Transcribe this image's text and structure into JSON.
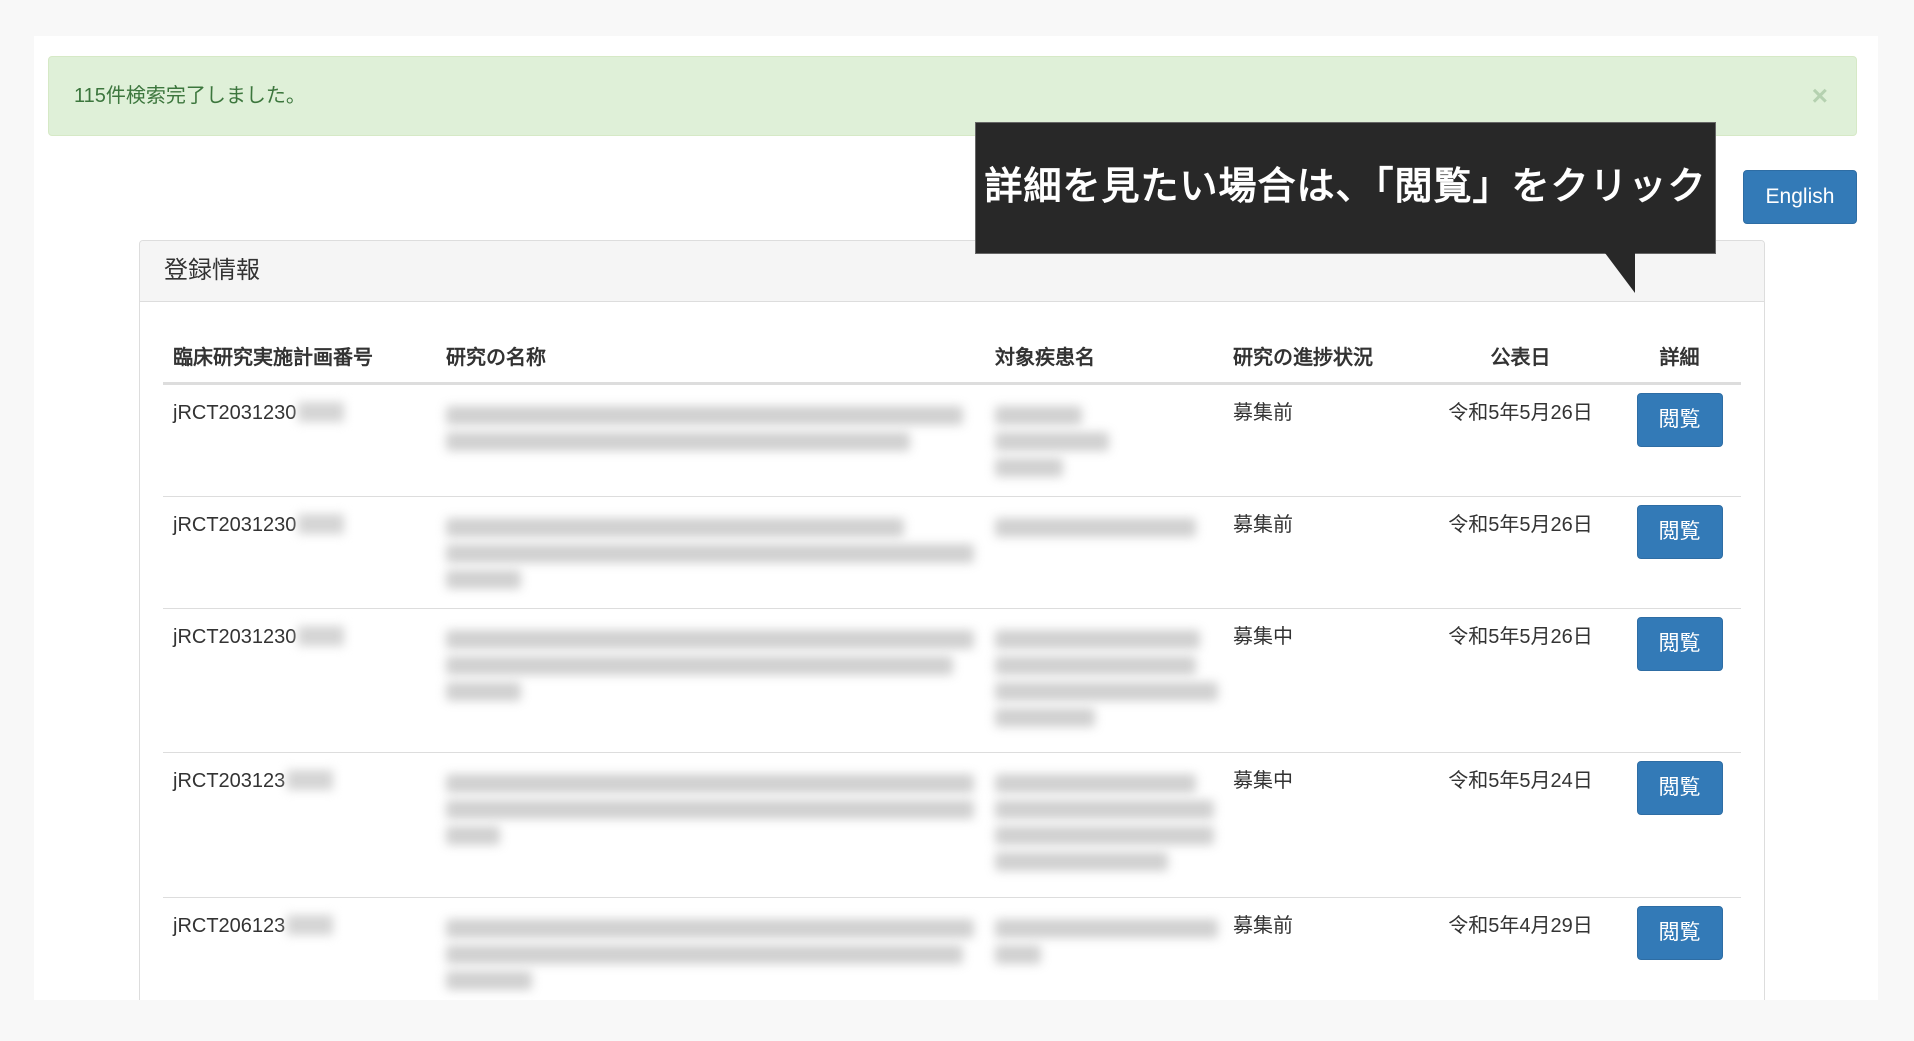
{
  "alert": {
    "message": "115件検索完了しました。",
    "close_label": "×"
  },
  "language_button": "English",
  "callout": {
    "text": "詳細を見たい場合は、「閲覧」をクリック"
  },
  "panel": {
    "title": "登録情報"
  },
  "table": {
    "headers": [
      "臨床研究実施計画番号",
      "研究の名称",
      "対象疾患名",
      "研究の進捗状況",
      "公表日",
      "詳細"
    ],
    "rows": [
      {
        "id_prefix": "jRCT203123",
        "id_visible": "jRCT2031230",
        "title_redacted": true,
        "disease_redacted": true,
        "status": "募集前",
        "date": "令和5年5月26日",
        "action": "閲覧"
      },
      {
        "id_prefix": "jRCT203123",
        "id_visible": "jRCT2031230",
        "title_redacted": true,
        "disease_redacted": true,
        "status": "募集前",
        "date": "令和5年5月26日",
        "action": "閲覧"
      },
      {
        "id_prefix": "jRCT203123",
        "id_visible": "jRCT2031230",
        "title_redacted": true,
        "disease_redacted": true,
        "status": "募集中",
        "date": "令和5年5月26日",
        "action": "閲覧"
      },
      {
        "id_prefix": "jRCT203123",
        "id_visible": "jRCT203123",
        "title_redacted": true,
        "disease_redacted": true,
        "status": "募集中",
        "date": "令和5年5月24日",
        "action": "閲覧"
      },
      {
        "id_prefix": "jRCT206123",
        "id_visible": "jRCT206123",
        "title_redacted": true,
        "disease_redacted": true,
        "status": "募集前",
        "date": "令和5年4月29日",
        "action": "閲覧"
      }
    ]
  },
  "colors": {
    "alert_bg": "#dff0d8",
    "alert_text": "#3c763d",
    "primary_button": "#337ab7",
    "callout_bg": "#282828"
  }
}
